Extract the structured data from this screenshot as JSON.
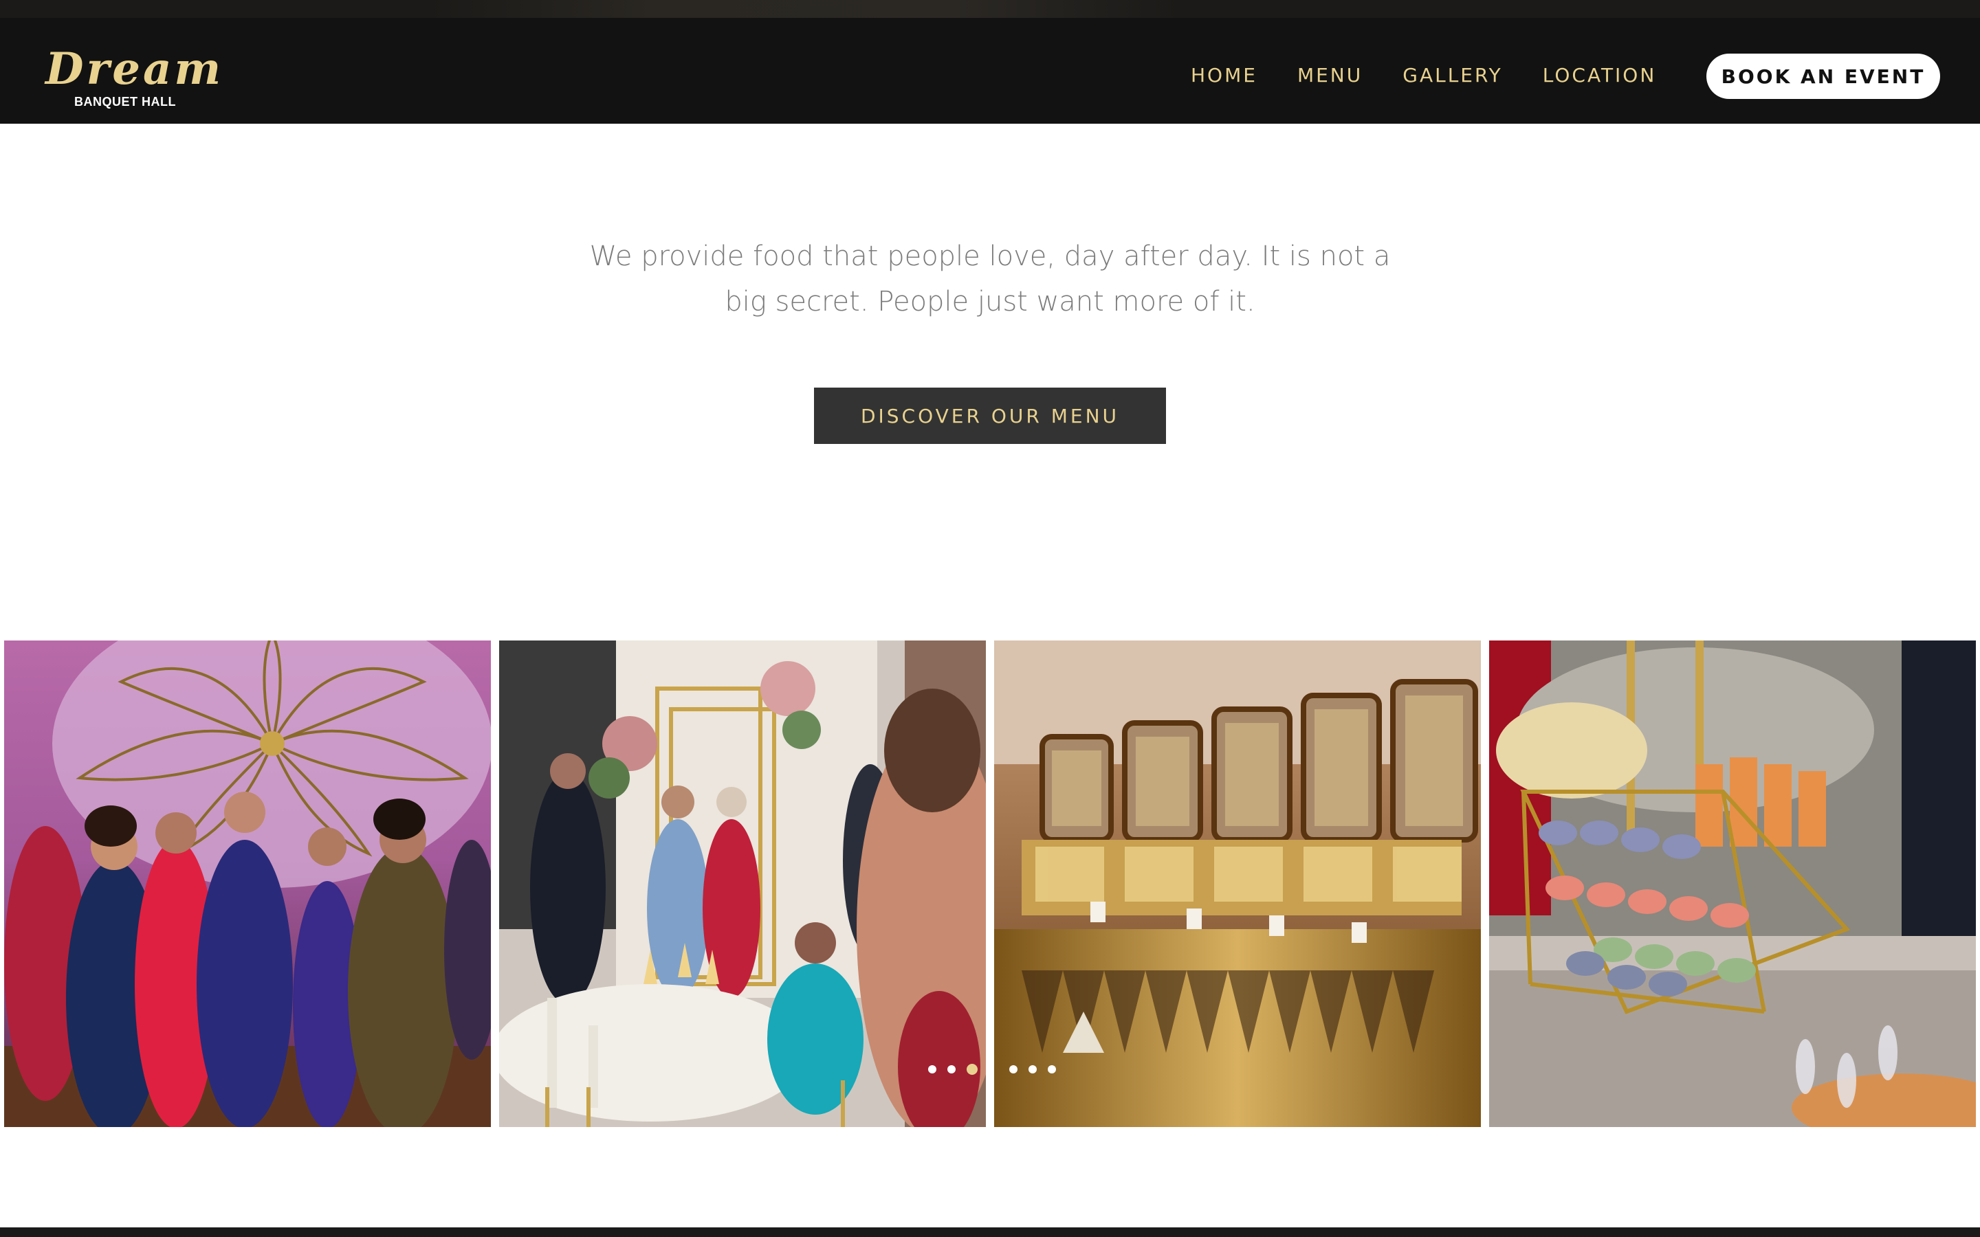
{
  "brand": {
    "logo_script": "Dream",
    "logo_sub": "BANQUET HALL"
  },
  "nav": {
    "items": [
      {
        "label": "HOME"
      },
      {
        "label": "MENU"
      },
      {
        "label": "GALLERY"
      },
      {
        "label": "LOCATION"
      }
    ],
    "cta_label": "BOOK AN EVENT"
  },
  "intro": {
    "tagline": "We provide food that people love, day after day. It is not a big secret. People just want more of it.",
    "button_label": "DISCOVER OUR MENU"
  },
  "gallery": {
    "slides": [
      {
        "subject": "dancing-guests"
      },
      {
        "subject": "guests-at-floral-arch"
      },
      {
        "subject": "buffet-chafing-dishes"
      },
      {
        "subject": "macaron-display"
      }
    ],
    "pagination": {
      "count": 6,
      "active": 3
    }
  },
  "colors": {
    "accent_gold": "#e9d28f",
    "nav_background": "#121212",
    "button_dark": "#333333",
    "tagline_text": "#7b7b7b"
  }
}
